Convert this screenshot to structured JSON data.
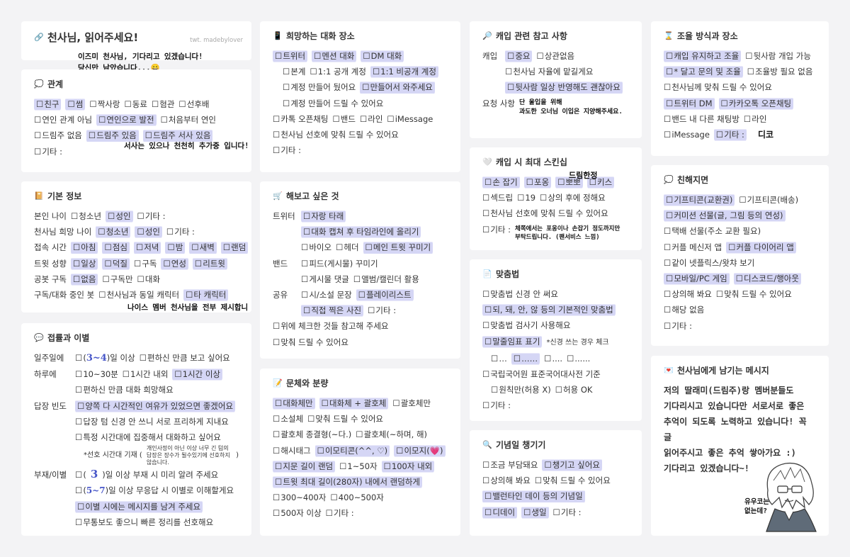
{
  "title": "천사님, 읽어주세요!",
  "credit": "twt. madebylover",
  "intro": [
    "이즈미 천사님, 기다리고 있겠습니다!",
    "당신만 남았습니다...😄"
  ],
  "relation": {
    "title": "관계",
    "rows": [
      [
        "친구",
        "썸",
        "짝사랑",
        "동료",
        "혐관",
        "선후배"
      ],
      [
        "연인 관계 아님",
        "연인으로 발전",
        "처음부터 연인"
      ],
      [
        "드림주 없음",
        "드림주 있음",
        "드림주 서사 있음"
      ]
    ],
    "note": "서사는 있으나 천천히 추가중 입니다!",
    "etc": "기타 :"
  },
  "basic": {
    "title": "기본 정보",
    "rows": [
      {
        "label": "본인 나이",
        "opts": [
          "청소년",
          "성인",
          "기타 :"
        ]
      },
      {
        "label": "천사님 희망 나이",
        "opts": [
          "청소년",
          "성인",
          "기타 :"
        ]
      },
      {
        "label": "접속 시간",
        "opts": [
          "아침",
          "점심",
          "저녁",
          "밤",
          "새벽",
          "랜덤"
        ]
      },
      {
        "label": "트윗 성향",
        "opts": [
          "일상",
          "덕질",
          "구독",
          "연성",
          "리트윗"
        ]
      },
      {
        "label": "공봇 구독",
        "opts": [
          "없음",
          "구독만",
          "대화"
        ]
      },
      {
        "label": "구독/대화 중인 봇",
        "opts": [
          "천사님과 동일 캐릭터",
          "타 캐릭터"
        ]
      }
    ],
    "note": "나이스 멤버 천사님을 전부 제시합니다."
  },
  "contact": {
    "title": "접률과 이별",
    "weekly_label": "일주일에",
    "weekly_a": "(",
    "weekly_num": "3~4",
    "weekly_b": ")일 이상",
    "weekly_c": "편하신 만큼 보고 싶어요",
    "daily_label": "하루에",
    "daily": [
      "10~30분",
      "1시간 내외",
      "1시간 이상"
    ],
    "daily2": "편하신 만큼 대화 희망해요",
    "reply_label": "답장 빈도",
    "reply": [
      "양쪽 다 시간적인 여유가 있었으면 좋겠어요",
      "답장 텀 신경 안 쓰니 서로 프리하게 지내요",
      "특정 시간대에 집중해서 대화하고 싶어요"
    ],
    "pref": "*선호 시간대 기재 (",
    "pref_note": "개인사정이 아닌 이상 너무 긴 텀의 답장은 장수가 될수있기에 선호하지 않습니다.",
    "pref_end": ")",
    "absence_label": "부재/이별",
    "abs_num1": "3",
    "abs_a": ")일 이상 부재 시 미리 알려 주세요",
    "abs_num2": "5~7",
    "abs_b": ")일 이상 무응답 시 이별로 이해할게요",
    "abs_c": "이별 시에는 메시지를 남겨 주세요",
    "abs_d": "무통보도 좋으니 빠른 정리를 선호해요"
  },
  "place": {
    "title": "희망하는 대화 장소",
    "rows": [
      {
        "opts": [
          "트위터",
          "멘션 대화",
          "DM 대화"
        ]
      },
      {
        "opts": [
          "본계",
          "1:1 공개 계정",
          "1:1 비공개 계정"
        ]
      },
      {
        "opts": [
          "계정 만들어 뒀어요",
          "만들어서 와주세요"
        ]
      },
      {
        "opts": [
          "계정 만들어 드릴 수 있어요"
        ]
      },
      {
        "opts": [
          "카톡 오픈채팅",
          "밴드",
          "라인",
          "iMessage"
        ]
      },
      {
        "opts": [
          "천사님 선호에 맞춰 드릴 수 있어요"
        ]
      },
      {
        "opts": [
          "기타 :"
        ]
      }
    ]
  },
  "try": {
    "title": "해보고 싶은 것",
    "twitter_label": "트위터",
    "twitter": [
      [
        "자랑 타래"
      ],
      [
        "대화 캡쳐 후 타임라인에 올리기"
      ],
      [
        "바이오",
        "헤더",
        "메인 트윗 꾸미기"
      ]
    ],
    "band_label": "밴드",
    "band": [
      [
        "피드(게시물) 꾸미기"
      ],
      [
        "게시물 댓글",
        "앨범/캘린더 활용"
      ]
    ],
    "share_label": "공유",
    "share": [
      [
        "시/소설 문장",
        "플레이리스트"
      ],
      [
        "직접 찍은 사진",
        "기타 :"
      ]
    ],
    "extra": [
      "위에 체크한 것들 참고해 주세요",
      "맞춰 드릴 수 있어요"
    ]
  },
  "style": {
    "title": "문체와 분량",
    "rows": [
      [
        "대화체만",
        "대화체 + 괄호체",
        "괄호체만"
      ],
      [
        "소설체",
        "맞춰 드릴 수 있어요"
      ],
      [
        "괄호체 종결형(~다.)",
        "괄호체(~하며, 해)"
      ],
      [
        "해시태그",
        "이모티콘(^^, ♡)",
        "이모지(💗)"
      ],
      [
        "지문 길이 랜덤",
        "1~50자",
        "100자 내외"
      ],
      [
        "트윗 최대 길이(280자) 내에서 랜덤하게"
      ],
      [
        "300~400자",
        "400~500자"
      ],
      [
        "500자 이상",
        "기타 :"
      ]
    ]
  },
  "cap": {
    "title": "캐입 관련 참고 사항",
    "cap_label": "캐입",
    "rows": [
      [
        "중요",
        "상관없음"
      ],
      [
        "천사님 자율에 맡길게요"
      ],
      [
        "뒷사람 일상 반영해도 괜찮아요"
      ]
    ],
    "req_label": "요청 사항",
    "req_note": [
      "단 울입을 위해",
      "과도한 오너님 이입은 지양해주세요."
    ]
  },
  "skin": {
    "title": "캐입 시 최대 스킨십",
    "hand": "드림한정",
    "rows": [
      [
        "손 잡기",
        "포옹",
        "뽀뽀",
        "키스"
      ],
      [
        "섹드립",
        "19",
        "상의 후에 정해요"
      ],
      [
        "천사님 선호에 맞춰 드릴 수 있어요"
      ]
    ],
    "etc": "기타 :",
    "etc_note": [
      "체쪽에서는 포옹이나 손잡기 정도까지만",
      "부탁드립니다. (팬서비스 느낌)"
    ]
  },
  "speech": {
    "title": "맞춤법",
    "rows": [
      [
        "맞춤법 신경 안 써요"
      ],
      [
        "되, 돼, 안, 않 등의 기본적인 맞춤법"
      ],
      [
        "맞춤법 검사기 사용해요"
      ]
    ],
    "mark": "말줄임표 표기",
    "mark_note": "*신경 쓰는 경우 체크",
    "marks": [
      "…",
      "……",
      "....",
      "......"
    ],
    "rows2": [
      [
        "국립국어원 표준국어대사전 기준"
      ],
      [
        "원칙만(허용 X)",
        "허용 OK"
      ],
      [
        "기타 :"
      ]
    ]
  },
  "anniv": {
    "title": "기념일 챙기기",
    "rows": [
      [
        "조금 부담돼요",
        "챙기고 싶어요"
      ],
      [
        "상의해 봐요",
        "맞춰 드릴 수 있어요"
      ],
      [
        "밸런타인 데이 등의 기념일"
      ],
      [
        "디데이",
        "생일",
        "기타 :"
      ]
    ]
  },
  "adjust": {
    "title": "조율 방식과 장소",
    "rows": [
      [
        "캐입 유지하고 조율",
        "뒷사람 개입 가능"
      ],
      [
        "* 달고 문의 및 조율",
        "조율방 필요 없음"
      ],
      [
        "천사님께 맞춰 드릴 수 있어요"
      ],
      [
        "트위터 DM",
        "카카오톡 오픈채팅"
      ],
      [
        "밴드 내 다른 채팅방",
        "라인"
      ],
      [
        "iMessage",
        "기타 :"
      ]
    ],
    "hand": "디코"
  },
  "close": {
    "title": "친해지면",
    "rows": [
      [
        "기프티콘(교환권)",
        "기프티콘(배송)"
      ],
      [
        "커미션 선물(글, 그림 등의 연성)"
      ],
      [
        "택배 선물(주소 교환 필요)"
      ],
      [
        "커플 메신저 앱",
        "커플 다이어리 앱"
      ],
      [
        "같이 넷플릭스/왓챠 보기"
      ],
      [
        "모바일/PC 게임",
        "디스코드/행아웃"
      ],
      [
        "상의해 봐요",
        "맞춰 드릴 수 있어요"
      ],
      [
        "해당 없음"
      ],
      [
        "기타 :"
      ]
    ]
  },
  "message": {
    "title": "천사님에게 남기는 메시지",
    "lines": [
      "저의 딸래미(드림주)랑 멤버분들도",
      "기다리시고 있습니다만 서로서로 좋은",
      "추억이 되도록 노력하고 있습니다! 꼭 글",
      "읽어주시고 좋은 추억 쌓아가요 :)",
      "기다리고 있겠습니다~!"
    ],
    "bubble": [
      "유우코는",
      "없는데?"
    ]
  }
}
